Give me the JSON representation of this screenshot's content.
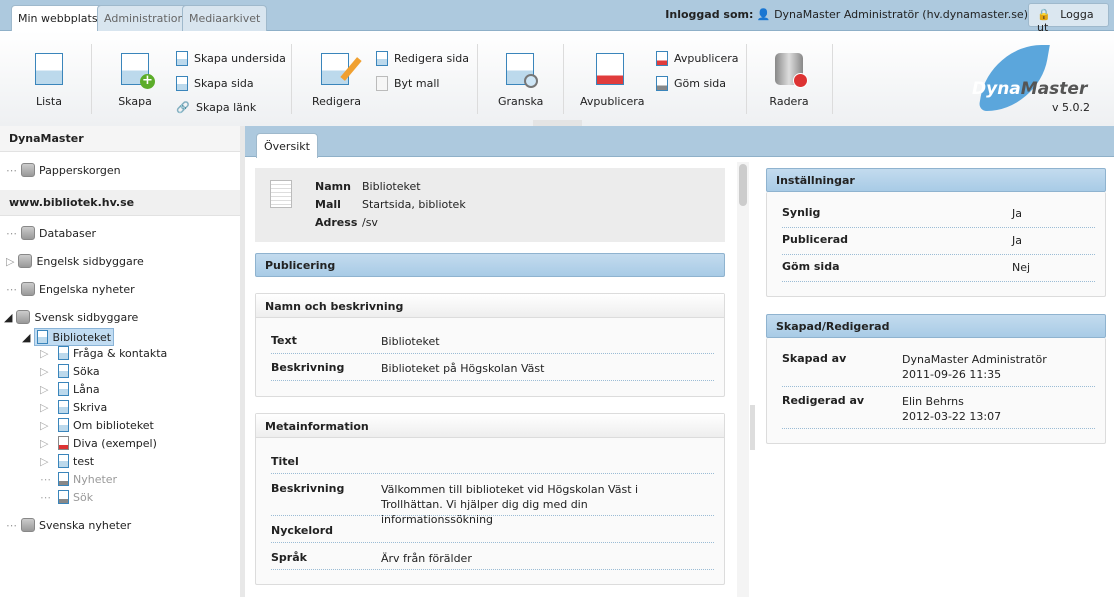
{
  "top_tabs": [
    "Min webbplats",
    "Administration",
    "Mediaarkivet"
  ],
  "login": {
    "label": "Inloggad som:",
    "user": "DynaMaster Administratör (hv.dynamaster.se)",
    "logout": "Logga ut"
  },
  "toolbar": {
    "lista": "Lista",
    "skapa": "Skapa",
    "skapa_undersida": "Skapa undersida",
    "skapa_sida": "Skapa sida",
    "skapa_lank": "Skapa länk",
    "redigera": "Redigera",
    "redigera_sida": "Redigera sida",
    "byt_mall": "Byt mall",
    "granska": "Granska",
    "avpublicera": "Avpublicera",
    "avpublicera_small": "Avpublicera",
    "gom_sida": "Göm sida",
    "radera": "Radera"
  },
  "logo": {
    "text1": "Dyna",
    "text2": "Master",
    "version": "v 5.0.2",
    "color": "#5ba6dc"
  },
  "sidebar": {
    "head1": "DynaMaster",
    "trash": "Papperskorgen",
    "head2": "www.bibliotek.hv.se",
    "roots": [
      "Databaser",
      "Engelsk sidbyggare",
      "Engelska nyheter",
      "Svensk sidbyggare"
    ],
    "selected": "Biblioteket",
    "children": [
      "Fråga & kontakta",
      "Söka",
      "Låna",
      "Skriva",
      "Om biblioteket",
      "Diva (exempel)",
      "test",
      "Nyheter",
      "Sök"
    ],
    "last": "Svenska nyheter"
  },
  "main": {
    "tab": "Översikt",
    "summary": {
      "namn_l": "Namn",
      "namn": "Biblioteket",
      "mall_l": "Mall",
      "mall": "Startsida, bibliotek",
      "adress_l": "Adress",
      "adress": "/sv"
    },
    "publicering": "Publicering",
    "nob": {
      "title": "Namn och beskrivning",
      "text_l": "Text",
      "text": "Biblioteket",
      "besk_l": "Beskrivning",
      "besk": "Biblioteket på Högskolan Väst"
    },
    "meta": {
      "title": "Metainformation",
      "titel_l": "Titel",
      "besk_l": "Beskrivning",
      "besk": "Välkommen till biblioteket vid Högskolan Väst i Trollhättan. Vi hjälper dig dig med din informationssökning",
      "nyckel_l": "Nyckelord",
      "sprak_l": "Språk",
      "sprak": "Ärv från förälder"
    }
  },
  "right": {
    "settings": {
      "title": "Inställningar",
      "synlig_l": "Synlig",
      "synlig": "Ja",
      "pub_l": "Publicerad",
      "pub": "Ja",
      "gom_l": "Göm sida",
      "gom": "Nej"
    },
    "created": {
      "title": "Skapad/Redigerad",
      "skapad_l": "Skapad av",
      "skapad_by": "DynaMaster Administratör",
      "skapad_date": "2011-09-26 11:35",
      "red_l": "Redigerad av",
      "red_by": "Elin Behrns",
      "red_date": "2012-03-22 13:07"
    }
  }
}
